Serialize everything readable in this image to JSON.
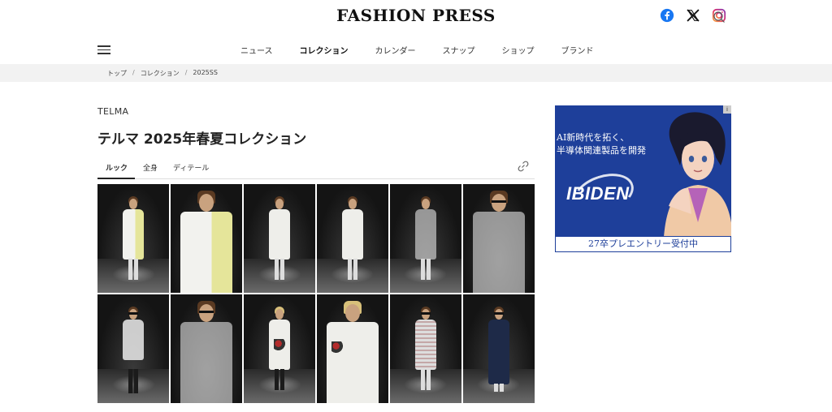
{
  "header": {
    "logo": "FASHION PRESS",
    "social": [
      {
        "icon": "facebook-icon",
        "color": "#1877f2"
      },
      {
        "icon": "x-icon",
        "color": "#111111"
      },
      {
        "icon": "instagram-icon",
        "color": "#c13584"
      }
    ],
    "search_icon": "search-icon"
  },
  "nav": {
    "menu_icon": "hamburger-menu-icon",
    "items": [
      {
        "label": "ニュース",
        "active": false
      },
      {
        "label": "コレクション",
        "active": true
      },
      {
        "label": "カレンダー",
        "active": false
      },
      {
        "label": "スナップ",
        "active": false
      },
      {
        "label": "ショップ",
        "active": false
      },
      {
        "label": "ブランド",
        "active": false
      }
    ]
  },
  "breadcrumb": [
    "トップ",
    "コレクション",
    "2025SS"
  ],
  "main": {
    "brand": "TELMA",
    "title": "テルマ 2025年春夏コレクション",
    "tabs": [
      {
        "label": "ルック",
        "active": true
      },
      {
        "label": "全身",
        "active": false
      },
      {
        "label": "ディテール",
        "active": false
      }
    ],
    "share_icon": "link-icon"
  },
  "looks": [
    "look-1",
    "look-2",
    "look-3",
    "look-4",
    "look-5",
    "look-6",
    "look-7",
    "look-8",
    "look-9",
    "look-10",
    "look-11",
    "look-12"
  ],
  "ad": {
    "badge": "i",
    "headline_1": "AI新時代を拓く、",
    "headline_2": "半導体関連製品を開発",
    "brand": "IBIDEN",
    "cta": "27卒プレエントリー受付中",
    "brand_color": "#1e3f9a"
  }
}
